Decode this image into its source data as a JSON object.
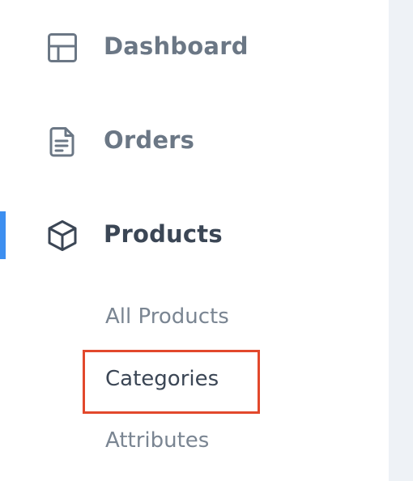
{
  "sidebar": {
    "nav": [
      {
        "label": "Dashboard",
        "icon": "dashboard-icon"
      },
      {
        "label": "Orders",
        "icon": "document-icon"
      },
      {
        "label": "Products",
        "icon": "box-icon",
        "active": true
      }
    ],
    "products_submenu": [
      {
        "label": "All Products"
      },
      {
        "label": "Categories",
        "highlighted": true
      },
      {
        "label": "Attributes"
      }
    ]
  },
  "colors": {
    "active_indicator": "#3d8ff0",
    "highlight_border": "#e2482c",
    "text_muted": "#6b7785",
    "text_active": "#3b4655",
    "content_background": "#eef2f6"
  }
}
